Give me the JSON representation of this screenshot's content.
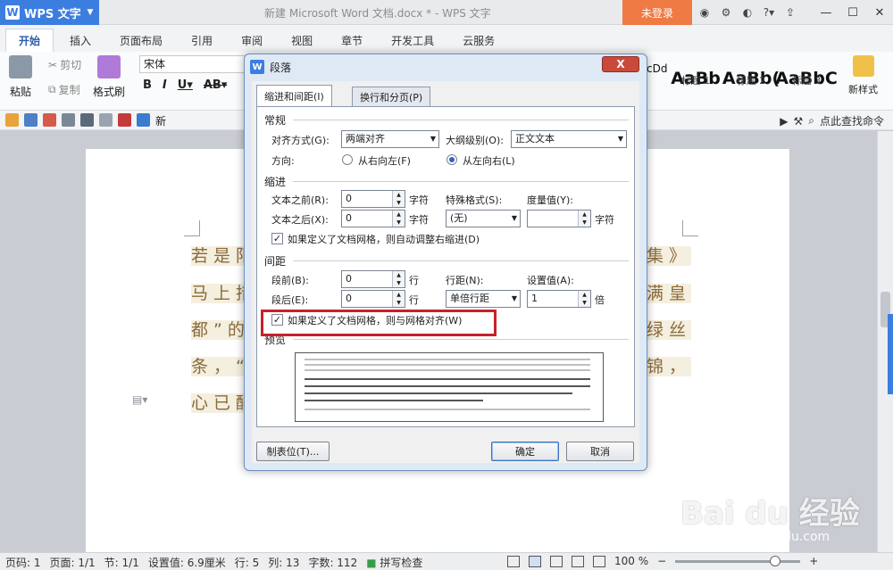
{
  "app": {
    "name": "WPS 文字",
    "doc_title": "新建 Microsoft Word 文档.docx * - WPS 文字",
    "login": "未登录",
    "brand_color": "#3c7de0",
    "login_color": "#f07a44"
  },
  "tabs": [
    "开始",
    "插入",
    "页面布局",
    "引用",
    "审阅",
    "视图",
    "章节",
    "开发工具",
    "云服务"
  ],
  "ribbon": {
    "paste": "粘贴",
    "cut": "剪切",
    "copy": "复制",
    "format_painter": "格式刷",
    "font": "宋体",
    "styles": [
      {
        "sample": "AaBb",
        "label": "标题 1"
      },
      {
        "sample": "AaBb(",
        "label": "标题 2"
      },
      {
        "sample": "AaBbC",
        "label": "标题 3"
      }
    ],
    "new_style": "新样式",
    "style_partial": "cDd"
  },
  "quick_access": {
    "search": "点此查找命令",
    "new_partial": "新"
  },
  "document": {
    "lines": [
      "若是阳",
      "马上措",
      "都”的",
      "条，“",
      "心已醉"
    ],
    "right_lines": [
      "集》",
      "满皇",
      "绿丝",
      "锦，"
    ]
  },
  "dialog": {
    "title": "段落",
    "close": "X",
    "tabs": [
      "缩进和间距(I)",
      "换行和分页(P)"
    ],
    "general": {
      "heading": "常规",
      "align_label": "对齐方式(G):",
      "align_value": "两端对齐",
      "outline_label": "大纲级别(O):",
      "outline_value": "正文文本",
      "direction_label": "方向:",
      "rtl": "从右向左(F)",
      "ltr": "从左向右(L)"
    },
    "indent": {
      "heading": "缩进",
      "before_label": "文本之前(R):",
      "before_value": "0",
      "before_unit": "字符",
      "after_label": "文本之后(X):",
      "after_value": "0",
      "after_unit": "字符",
      "special_label": "特殊格式(S):",
      "special_value": "(无)",
      "measure_label": "度量值(Y):",
      "measure_unit": "字符",
      "auto_adjust": "如果定义了文档网格，则自动调整右缩进(D)"
    },
    "spacing": {
      "heading": "间距",
      "before_label": "段前(B):",
      "before_value": "0",
      "before_unit": "行",
      "after_label": "段后(E):",
      "after_value": "0",
      "after_unit": "行",
      "line_label": "行距(N):",
      "line_value": "单倍行距",
      "setting_label": "设置值(A):",
      "setting_value": "1",
      "setting_unit": "倍",
      "snap_grid": "如果定义了文档网格，则与网格对齐(W)"
    },
    "preview_heading": "预览",
    "buttons": {
      "tabs": "制表位(T)...",
      "ok": "确定",
      "cancel": "取消"
    }
  },
  "statusbar": {
    "page_code": "页码: 1",
    "page": "页面: 1/1",
    "section": "节: 1/1",
    "setting": "设置值: 6.9厘米",
    "row": "行: 5",
    "col": "列: 13",
    "words": "字数: 112",
    "spell": "拼写检查",
    "zoom": "100 %",
    "zoom_percent": 100
  },
  "watermark": {
    "main": "Bai du 经验",
    "sub": "jingyan.baidu.com"
  }
}
